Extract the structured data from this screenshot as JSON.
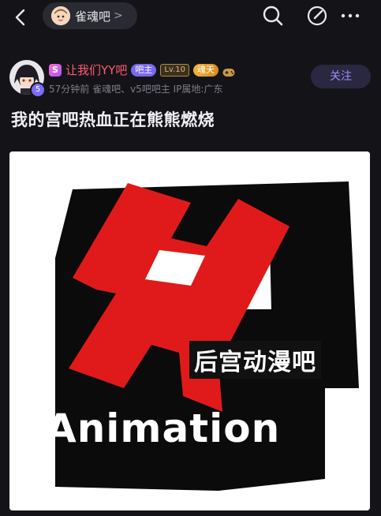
{
  "topbar": {
    "forum_name": "雀魂吧",
    "chevron": ">",
    "icons": [
      "back-icon",
      "search-icon",
      "edit-icon",
      "more-icon"
    ]
  },
  "author": {
    "s_badge": "S",
    "username": "让我们YY吧",
    "role_badge": "吧主",
    "level_badge": "Lv.10",
    "title_badge": "魂天",
    "level_dot": "5",
    "meta": "57分钟前    雀魂吧、v5吧吧主  IP属地:广东",
    "follow_label": "关注"
  },
  "post": {
    "title": "我的宫吧热血正在熊熊燃烧"
  },
  "image": {
    "logo_text_cn": "后宫动漫吧",
    "logo_text_en": "Animation"
  },
  "colors": {
    "background": "#141418",
    "accent_purple": "#9b8cff",
    "username_red": "#ff5a73",
    "logo_red": "#e01a1a"
  }
}
